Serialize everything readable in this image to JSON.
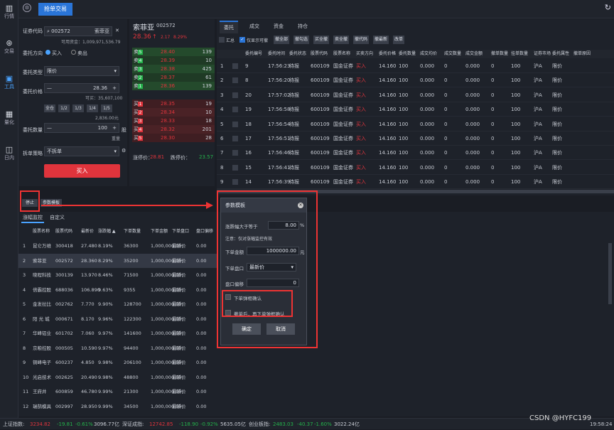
{
  "sidebar": [
    {
      "icon": "chart-icon",
      "label": "行情"
    },
    {
      "icon": "trade-icon",
      "label": "交易"
    },
    {
      "icon": "tools-icon",
      "label": "工具"
    },
    {
      "icon": "quant-icon",
      "label": "量化"
    },
    {
      "icon": "intraday-icon",
      "label": "日内"
    }
  ],
  "topbar": {
    "tab": "抢单交易"
  },
  "form": {
    "code_label": "证券代码",
    "code_value": "002572",
    "name_value": "索菲亚",
    "available": "可用资金：1,009,971,536.79",
    "direction_label": "委托方向",
    "buy": "买入",
    "sell": "卖出",
    "type_label": "委托类型",
    "type_value": "限价",
    "price_label": "委托价格",
    "price_value": "28.36",
    "buyable": "可买：35,607,100",
    "qty_btns": [
      "全仓",
      "1/2",
      "1/3",
      "1/4",
      "1/5"
    ],
    "qty_hint": "2,836.00元",
    "qty_label": "委托数量",
    "qty_value": "100",
    "qty_unit": "股",
    "qty_sub": "重量",
    "split_label": "拆单策略",
    "split_value": "不拆单",
    "submit": "买入"
  },
  "quote": {
    "name": "索菲亚",
    "code": "002572",
    "price": "28.36",
    "change": "2.17",
    "pct": "8.29%",
    "sell": [
      {
        "tag": "卖",
        "n": "5",
        "price": "28.40",
        "vol": "139"
      },
      {
        "tag": "卖",
        "n": "4",
        "price": "28.39",
        "vol": "10"
      },
      {
        "tag": "卖",
        "n": "3",
        "price": "28.38",
        "vol": "425"
      },
      {
        "tag": "卖",
        "n": "2",
        "price": "28.37",
        "vol": "61"
      },
      {
        "tag": "卖",
        "n": "1",
        "price": "28.36",
        "vol": "139"
      }
    ],
    "buy": [
      {
        "tag": "买",
        "n": "1",
        "price": "28.35",
        "vol": "19"
      },
      {
        "tag": "买",
        "n": "2",
        "price": "28.34",
        "vol": "10"
      },
      {
        "tag": "买",
        "n": "3",
        "price": "28.33",
        "vol": "18"
      },
      {
        "tag": "买",
        "n": "4",
        "price": "28.32",
        "vol": "201"
      },
      {
        "tag": "买",
        "n": "5",
        "price": "28.30",
        "vol": "28"
      }
    ],
    "limit_up_label": "涨停价：",
    "limit_up": "28.81",
    "limit_down_label": "跌停价：",
    "limit_down": "23.57"
  },
  "orders": {
    "tabs": [
      "委托",
      "成交",
      "资金",
      "持仓"
    ],
    "summary": "汇总",
    "only_cancellable": "仅显示可撤",
    "buttons": [
      "撤全部",
      "撤勾选",
      "买全撤",
      "卖全撤",
      "撤代码",
      "撤最新",
      "改单"
    ],
    "headers": [
      "委托编号",
      "委托时间",
      "委托状态",
      "股票代码",
      "股票名称",
      "买卖方向",
      "委托价格",
      "委托数量",
      "成交均价",
      "成交数量",
      "成交金额",
      "撤单数量",
      "挂单数量",
      "证券市场",
      "委托属性",
      "撤单原因"
    ],
    "rows": [
      {
        "n": "1",
        "id": "9",
        "time": "17:56:23",
        "status": "待报",
        "code": "600109",
        "name": "国金证券",
        "dir": "买入",
        "price": "14.160",
        "qty": "100",
        "avg": "0.000",
        "dqty": "0",
        "amt": "0.000",
        "cqty": "0",
        "hqty": "100",
        "mkt": "沪A",
        "attr": "限价"
      },
      {
        "n": "2",
        "id": "8",
        "time": "17:56:20",
        "status": "待报",
        "code": "600109",
        "name": "国金证券",
        "dir": "买入",
        "price": "14.160",
        "qty": "100",
        "avg": "0.000",
        "dqty": "0",
        "amt": "0.000",
        "cqty": "0",
        "hqty": "100",
        "mkt": "沪A",
        "attr": "限价"
      },
      {
        "n": "3",
        "id": "20",
        "time": "17:57:02",
        "status": "待报",
        "code": "600109",
        "name": "国金证券",
        "dir": "买入",
        "price": "14.160",
        "qty": "100",
        "avg": "0.000",
        "dqty": "0",
        "amt": "0.000",
        "cqty": "0",
        "hqty": "100",
        "mkt": "沪A",
        "attr": "限价"
      },
      {
        "n": "4",
        "id": "19",
        "time": "17:56:58",
        "status": "待报",
        "code": "600109",
        "name": "国金证券",
        "dir": "买入",
        "price": "14.160",
        "qty": "100",
        "avg": "0.000",
        "dqty": "0",
        "amt": "0.000",
        "cqty": "0",
        "hqty": "100",
        "mkt": "沪A",
        "attr": "限价"
      },
      {
        "n": "5",
        "id": "18",
        "time": "17:56:54",
        "status": "待报",
        "code": "600109",
        "name": "国金证券",
        "dir": "买入",
        "price": "14.160",
        "qty": "100",
        "avg": "0.000",
        "dqty": "0",
        "amt": "0.000",
        "cqty": "0",
        "hqty": "100",
        "mkt": "沪A",
        "attr": "限价"
      },
      {
        "n": "6",
        "id": "17",
        "time": "17:56:51",
        "status": "待报",
        "code": "600109",
        "name": "国金证券",
        "dir": "买入",
        "price": "14.160",
        "qty": "100",
        "avg": "0.000",
        "dqty": "0",
        "amt": "0.000",
        "cqty": "0",
        "hqty": "100",
        "mkt": "沪A",
        "attr": "限价"
      },
      {
        "n": "7",
        "id": "16",
        "time": "17:56:46",
        "status": "待报",
        "code": "600109",
        "name": "国金证券",
        "dir": "买入",
        "price": "14.160",
        "qty": "100",
        "avg": "0.000",
        "dqty": "0",
        "amt": "0.000",
        "cqty": "0",
        "hqty": "100",
        "mkt": "沪A",
        "attr": "限价"
      },
      {
        "n": "8",
        "id": "15",
        "time": "17:56:41",
        "status": "待报",
        "code": "600109",
        "name": "国金证券",
        "dir": "买入",
        "price": "14.160",
        "qty": "100",
        "avg": "0.000",
        "dqty": "0",
        "amt": "0.000",
        "cqty": "0",
        "hqty": "100",
        "mkt": "沪A",
        "attr": "限价"
      },
      {
        "n": "9",
        "id": "14",
        "time": "17:56:39",
        "status": "待报",
        "code": "600109",
        "name": "国金证券",
        "dir": "买入",
        "price": "14.160",
        "qty": "100",
        "avg": "0.000",
        "dqty": "0",
        "amt": "0.000",
        "cqty": "0",
        "hqty": "100",
        "mkt": "沪A",
        "attr": "限价"
      }
    ]
  },
  "controls": {
    "stop": "停止",
    "params": "参数模板"
  },
  "bottom": {
    "tabs": [
      "涨幅监控",
      "自定义"
    ],
    "headers": [
      "股票名称",
      "股票代码",
      "最新价",
      "涨跌幅 ▲",
      "下单数量",
      "下单金额",
      "下单盘口",
      "盘口偏移"
    ],
    "rows": [
      {
        "n": "1",
        "name": "昆仑万维",
        "code": "300418",
        "price": "27.480",
        "pct": "8.19%",
        "qty": "36300",
        "amt": "1,000,000.00",
        "level": "最新价",
        "offset": "0.00"
      },
      {
        "n": "2",
        "name": "索菲亚",
        "code": "002572",
        "price": "28.360",
        "pct": "8.29%",
        "qty": "35200",
        "amt": "1,000,000.00",
        "level": "最新价",
        "offset": "0.00"
      },
      {
        "n": "3",
        "name": "晓程科技",
        "code": "300139",
        "price": "13.970",
        "pct": "8.46%",
        "qty": "71500",
        "amt": "1,000,000.00",
        "level": "最新价",
        "offset": "0.00"
      },
      {
        "n": "4",
        "name": "倍霸控股",
        "code": "688036",
        "price": "106.890",
        "pct": "9.63%",
        "qty": "9355",
        "amt": "1,000,000.00",
        "level": "最新价",
        "offset": "0.00"
      },
      {
        "n": "5",
        "name": "金发拉比",
        "code": "002762",
        "price": "7.770",
        "pct": "9.90%",
        "qty": "128700",
        "amt": "1,000,000.00",
        "level": "最新价",
        "offset": "0.00"
      },
      {
        "n": "6",
        "name": "阳 光 城",
        "code": "000671",
        "price": "8.170",
        "pct": "9.96%",
        "qty": "122300",
        "amt": "1,000,000.00",
        "level": "最新价",
        "offset": "0.00"
      },
      {
        "n": "7",
        "name": "华峰铝业",
        "code": "601702",
        "price": "7.060",
        "pct": "9.97%",
        "qty": "141600",
        "amt": "1,000,000.00",
        "level": "最新价",
        "offset": "0.00"
      },
      {
        "n": "8",
        "name": "京粮控股",
        "code": "000505",
        "price": "10.590",
        "pct": "9.97%",
        "qty": "94400",
        "amt": "1,000,000.00",
        "level": "最新价",
        "offset": "0.00"
      },
      {
        "n": "9",
        "name": "铜峰电子",
        "code": "600237",
        "price": "4.850",
        "pct": "9.98%",
        "qty": "206100",
        "amt": "1,000,000.00",
        "level": "最新价",
        "offset": "0.00"
      },
      {
        "n": "10",
        "name": "光启技术",
        "code": "002625",
        "price": "20.490",
        "pct": "9.98%",
        "qty": "48800",
        "amt": "1,000,000.00",
        "level": "最新价",
        "offset": "0.00"
      },
      {
        "n": "11",
        "name": "王府井",
        "code": "600859",
        "price": "46.780",
        "pct": "9.99%",
        "qty": "21300",
        "amt": "1,000,000.00",
        "level": "最新价",
        "offset": "0.00"
      },
      {
        "n": "12",
        "name": "瑞鹄模具",
        "code": "002997",
        "price": "28.950",
        "pct": "9.99%",
        "qty": "34500",
        "amt": "1,000,000.00",
        "level": "最新价",
        "offset": "0.00"
      }
    ]
  },
  "dialog": {
    "title": "参数模板",
    "cond_label": "涨跌幅大于等于",
    "cond_value": "8.00",
    "cond_unit": "%",
    "note": "注意：仅对涨幅监控有效",
    "amt_label": "下单金额",
    "amt_value": "1000000.00",
    "amt_unit": "元",
    "level_label": "下单盘口",
    "level_value": "最新价",
    "offset_label": "盘口偏移",
    "offset_value": "0",
    "chk1": "下单弹框确认",
    "chk2": "撤单后，再下单弹框确认",
    "ok": "确定",
    "cancel": "取消"
  },
  "status": {
    "sh_label": "上证指数:",
    "sh_val": "3234.82",
    "sh_ch": "-19.81",
    "sh_pct": "-0.61%",
    "sh_amt": "3096.77亿",
    "sz_label": "深证成指:",
    "sz_val": "12742.85",
    "sz_ch": "-118.90",
    "sz_pct": "-0.92%",
    "sz_amt": "5635.05亿",
    "cy_label": "创业板指:",
    "cy_val": "2483.03",
    "cy_ch": "-40.37",
    "cy_pct": "-1.60%",
    "cy_amt": "3022.24亿",
    "watermark": "CSDN @HYFC199",
    "time": "19:58:24"
  }
}
